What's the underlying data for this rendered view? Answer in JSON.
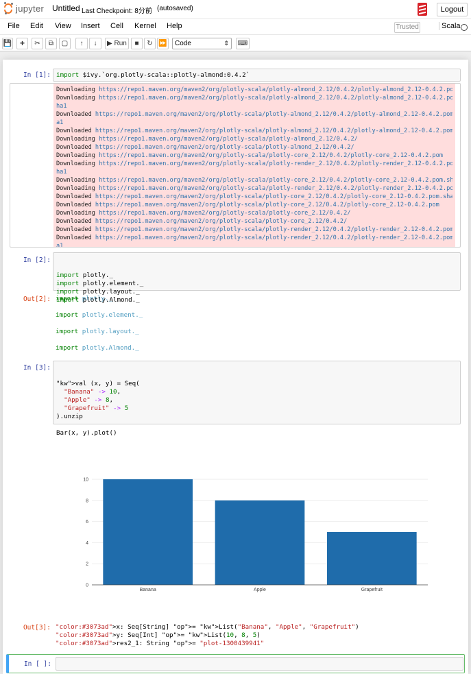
{
  "header": {
    "logo_text": "jupyter",
    "notebook_title": "Untitled",
    "checkpoint": "Last Checkpoint: 8分前",
    "autosave": "(autosaved)",
    "logout_label": "Logout"
  },
  "menubar": {
    "items": [
      "File",
      "Edit",
      "View",
      "Insert",
      "Cell",
      "Kernel",
      "Help"
    ],
    "trusted": "Trusted",
    "kernel": "Scala"
  },
  "toolbar": {
    "run_label": "Run",
    "cell_type": "Code"
  },
  "cells": {
    "c1": {
      "prompt": "In [1]:",
      "code": "import $ivy.`org.plotly-scala::plotly-almond:0.4.2`",
      "stderr": [
        {
          "verb": "Downloading",
          "url": "https://repo1.maven.org/maven2/org/plotly-scala/plotly-almond_2.12/0.4.2/plotly-almond_2.12-0.4.2.pom"
        },
        {
          "verb": "Downloading",
          "url": "https://repo1.maven.org/maven2/org/plotly-scala/plotly-almond_2.12/0.4.2/plotly-almond_2.12-0.4.2.pom.s"
        },
        {
          "verb": "",
          "url": "ha1"
        },
        {
          "verb": "Downloaded",
          "url": "https://repo1.maven.org/maven2/org/plotly-scala/plotly-almond_2.12/0.4.2/plotly-almond_2.12-0.4.2.pom.sh"
        },
        {
          "verb": "",
          "url": "a1"
        },
        {
          "verb": "Downloaded",
          "url": "https://repo1.maven.org/maven2/org/plotly-scala/plotly-almond_2.12/0.4.2/plotly-almond_2.12-0.4.2.pom"
        },
        {
          "verb": "Downloading",
          "url": "https://repo1.maven.org/maven2/org/plotly-scala/plotly-almond_2.12/0.4.2/"
        },
        {
          "verb": "Downloaded",
          "url": "https://repo1.maven.org/maven2/org/plotly-scala/plotly-almond_2.12/0.4.2/"
        },
        {
          "verb": "Downloading",
          "url": "https://repo1.maven.org/maven2/org/plotly-scala/plotly-core_2.12/0.4.2/plotly-core_2.12-0.4.2.pom"
        },
        {
          "verb": "Downloading",
          "url": "https://repo1.maven.org/maven2/org/plotly-scala/plotly-render_2.12/0.4.2/plotly-render_2.12-0.4.2.pom.s"
        },
        {
          "verb": "",
          "url": "ha1"
        },
        {
          "verb": "Downloading",
          "url": "https://repo1.maven.org/maven2/org/plotly-scala/plotly-core_2.12/0.4.2/plotly-core_2.12-0.4.2.pom.sha1"
        },
        {
          "verb": "Downloading",
          "url": "https://repo1.maven.org/maven2/org/plotly-scala/plotly-render_2.12/0.4.2/plotly-render_2.12-0.4.2.pom"
        },
        {
          "verb": "Downloaded",
          "url": "https://repo1.maven.org/maven2/org/plotly-scala/plotly-core_2.12/0.4.2/plotly-core_2.12-0.4.2.pom.sha1"
        },
        {
          "verb": "Downloaded",
          "url": "https://repo1.maven.org/maven2/org/plotly-scala/plotly-core_2.12/0.4.2/plotly-core_2.12-0.4.2.pom"
        },
        {
          "verb": "Downloading",
          "url": "https://repo1.maven.org/maven2/org/plotly-scala/plotly-core_2.12/0.4.2/"
        },
        {
          "verb": "Downloaded",
          "url": "https://repo1.maven.org/maven2/org/plotly-scala/plotly-core_2.12/0.4.2/"
        },
        {
          "verb": "Downloaded",
          "url": "https://repo1.maven.org/maven2/org/plotly-scala/plotly-render_2.12/0.4.2/plotly-render_2.12-0.4.2.pom"
        },
        {
          "verb": "Downloaded",
          "url": "https://repo1.maven.org/maven2/org/plotly-scala/plotly-render_2.12/0.4.2/plotly-render_2.12-0.4.2.pom.sh"
        },
        {
          "verb": "",
          "url": "a1"
        }
      ]
    },
    "c2": {
      "prompt": "In [2]:",
      "code": [
        "import plotly._",
        "import plotly.element._",
        "import plotly.layout._",
        "import plotly.Almond._"
      ],
      "out_prompt": "Out[2]:",
      "output": [
        "plotly._",
        "plotly.element._",
        "plotly.layout._",
        "plotly.Almond._"
      ],
      "output_keyword": "import"
    },
    "c3": {
      "prompt": "In [3]:",
      "code": [
        "val (x, y) = Seq(",
        "  \"Banana\" -> 10,",
        "  \"Apple\" -> 8,",
        "  \"Grapefruit\" -> 5",
        ").unzip",
        "",
        "Bar(x, y).plot()"
      ],
      "out_prompt": "Out[3]:",
      "output": [
        "x: Seq[String] = List(\"Banana\", \"Apple\", \"Grapefruit\")",
        "y: Seq[Int] = List(10, 8, 5)",
        "res2_1: String = \"plot-1300439941\""
      ]
    },
    "c4": {
      "prompt": "In [ ]:"
    }
  },
  "chart_data": {
    "type": "bar",
    "categories": [
      "Banana",
      "Apple",
      "Grapefruit"
    ],
    "values": [
      10,
      8,
      5
    ],
    "ylim": [
      0,
      10
    ],
    "yticks": [
      0,
      2,
      4,
      6,
      8,
      10
    ],
    "grid": true,
    "bar_color": "#1f6cab"
  }
}
